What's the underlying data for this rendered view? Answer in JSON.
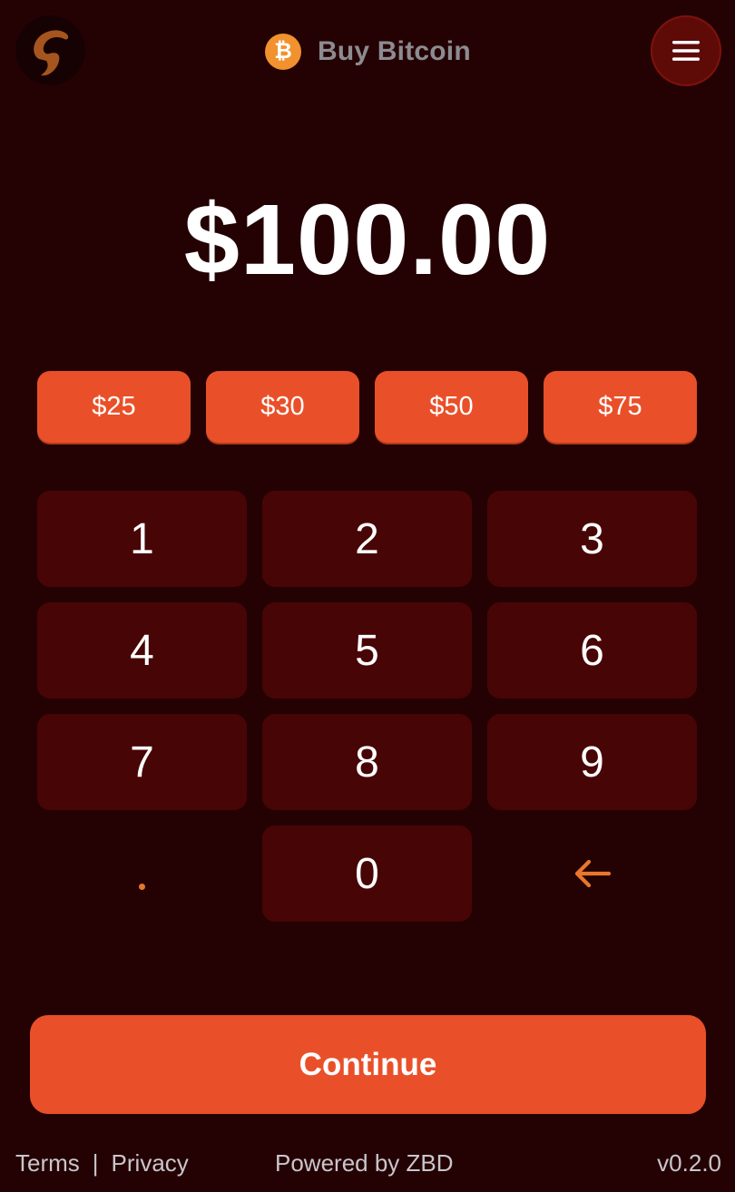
{
  "header": {
    "title": "Buy Bitcoin",
    "logo_icon": "brand-logo-icon",
    "coin_icon": "bitcoin-icon",
    "coin_symbol": "₿",
    "menu_icon": "hamburger-menu-icon"
  },
  "amount": {
    "display": "$100.00"
  },
  "presets": [
    {
      "label": "$25"
    },
    {
      "label": "$30"
    },
    {
      "label": "$50"
    },
    {
      "label": "$75"
    }
  ],
  "keypad": {
    "keys": [
      "1",
      "2",
      "3",
      "4",
      "5",
      "6",
      "7",
      "8",
      "9"
    ],
    "zero": "0",
    "decimal_icon": "decimal-point-icon",
    "backspace_icon": "backspace-arrow-icon"
  },
  "continue_label": "Continue",
  "footer": {
    "terms": "Terms",
    "separator": "|",
    "privacy": "Privacy",
    "powered_by": "Powered by ZBD",
    "version": "v0.2.0"
  },
  "colors": {
    "background": "#240203",
    "accent": "#e95029",
    "key_bg": "#480506",
    "bitcoin": "#f1922e",
    "logo_brown": "#a6551f"
  }
}
